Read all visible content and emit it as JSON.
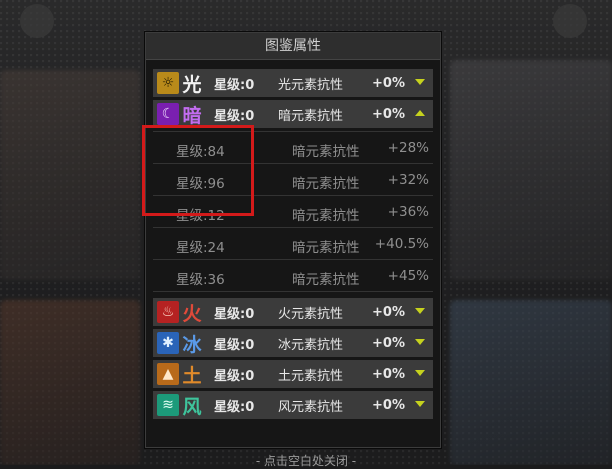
{
  "panel": {
    "title": "图鉴属性"
  },
  "elements": [
    {
      "char": "光",
      "icon": "sun-icon",
      "glyph": "☼",
      "level": "星级:0",
      "prop": "光元素抗性",
      "value": "+0%",
      "icon_bg": "#b98a1a",
      "char_color": "#f2f2f2",
      "expanded": false
    },
    {
      "char": "暗",
      "icon": "crescent-moon-icon",
      "glyph": "☾",
      "level": "星级:0",
      "prop": "暗元素抗性",
      "value": "+0%",
      "icon_bg": "#7a1fb0",
      "char_color": "#c26cf0",
      "expanded": true
    },
    {
      "char": "火",
      "icon": "flame-icon",
      "glyph": "♨",
      "level": "星级:0",
      "prop": "火元素抗性",
      "value": "+0%",
      "icon_bg": "#b52222",
      "char_color": "#e04a3a",
      "expanded": false
    },
    {
      "char": "冰",
      "icon": "snowflake-icon",
      "glyph": "✱",
      "level": "星级:0",
      "prop": "冰元素抗性",
      "value": "+0%",
      "icon_bg": "#2a64b8",
      "char_color": "#5a9ae8",
      "expanded": false
    },
    {
      "char": "土",
      "icon": "mountain-icon",
      "glyph": "▲",
      "level": "星级:0",
      "prop": "土元素抗性",
      "value": "+0%",
      "icon_bg": "#b86a1a",
      "char_color": "#e08a2a",
      "expanded": false
    },
    {
      "char": "风",
      "icon": "wind-swirl-icon",
      "glyph": "≋",
      "level": "星级:0",
      "prop": "风元素抗性",
      "value": "+0%",
      "icon_bg": "#1c9a7a",
      "char_color": "#3ec49c",
      "expanded": false
    }
  ],
  "dark_details": [
    {
      "level": "星级:84",
      "prop": "暗元素抗性",
      "value": "+28%"
    },
    {
      "level": "星级:96",
      "prop": "暗元素抗性",
      "value": "+32%"
    },
    {
      "level": "星级:12",
      "prop": "暗元素抗性",
      "value": "+36%"
    },
    {
      "level": "星级:24",
      "prop": "暗元素抗性",
      "value": "+40.5%"
    },
    {
      "level": "星级:36",
      "prop": "暗元素抗性",
      "value": "+45%"
    }
  ],
  "footer": {
    "hint": "- 点击空白处关闭 -"
  },
  "colors": {
    "accent": "#c6d21e",
    "highlight": "#d31a1a"
  }
}
